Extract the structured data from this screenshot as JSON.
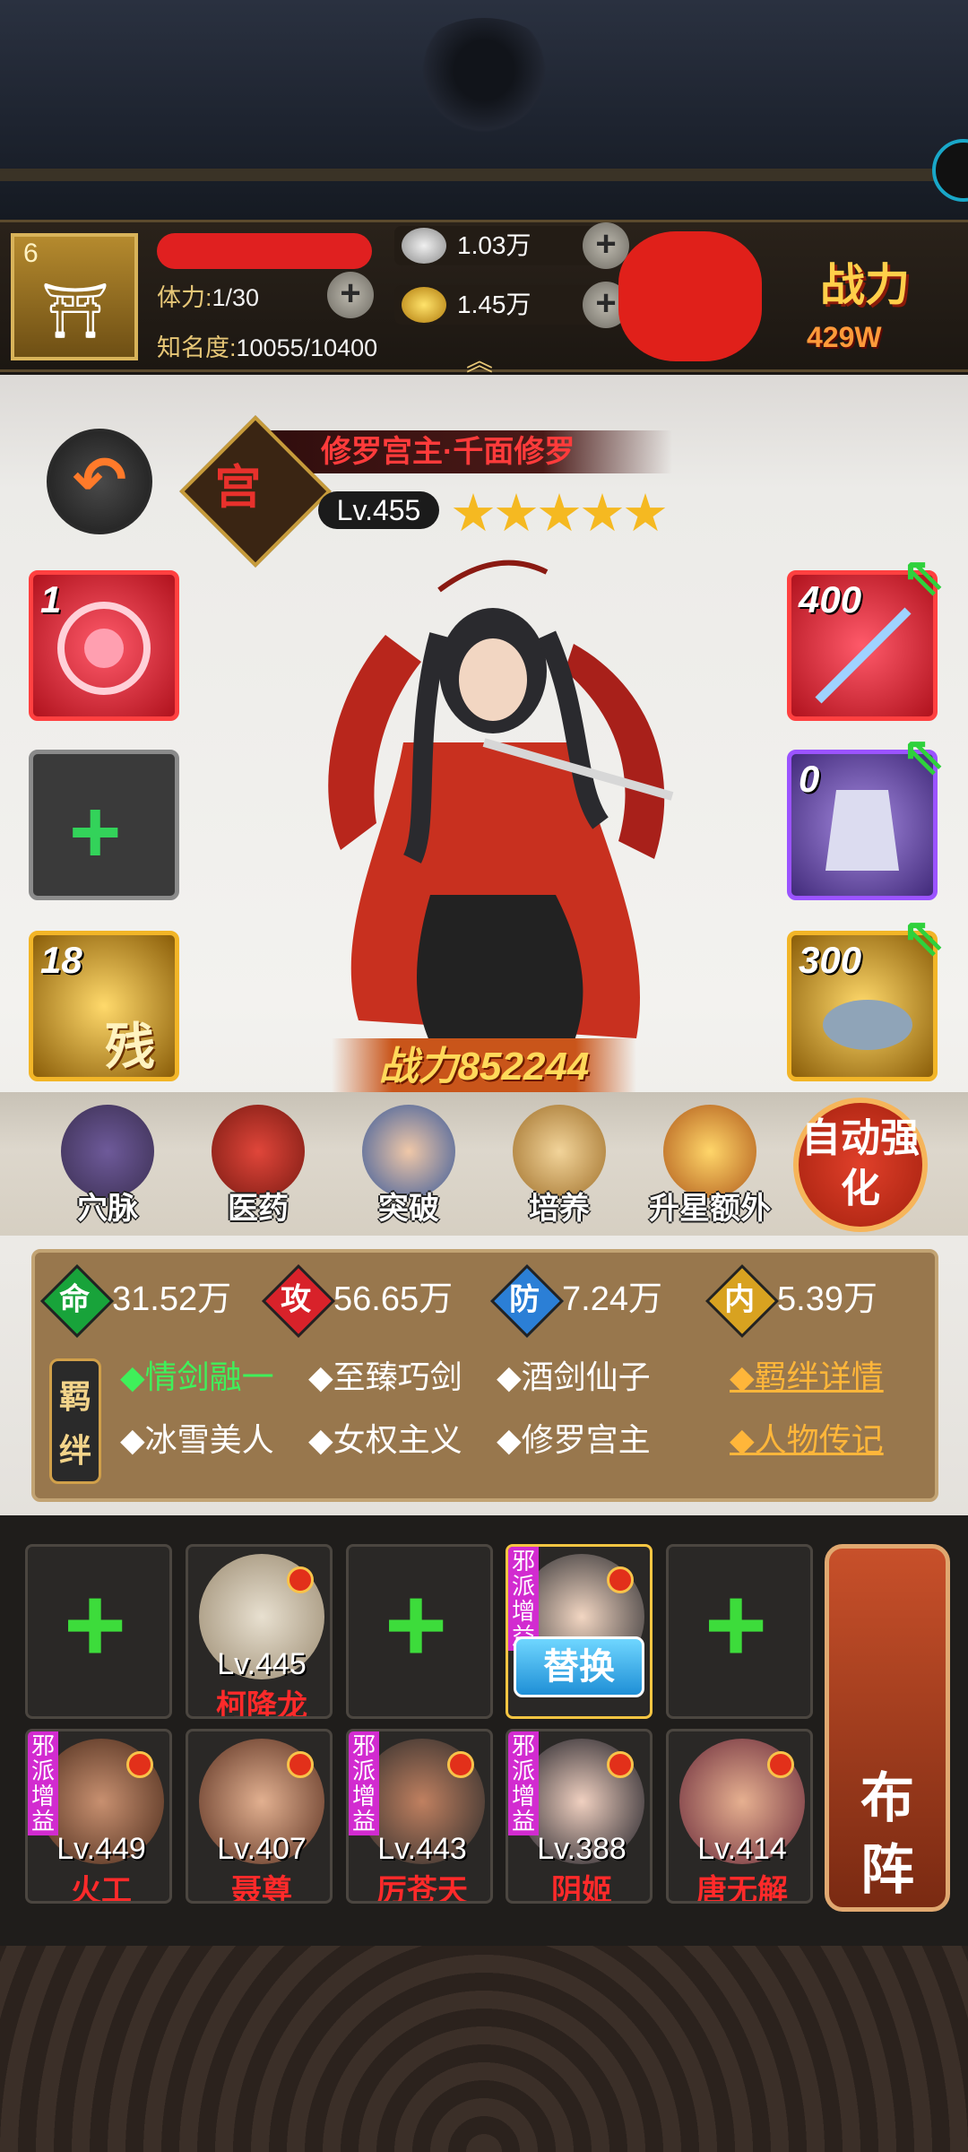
{
  "header": {
    "level": "6",
    "stamina_label": "体力:",
    "stamina_value": "1/30",
    "fame_label": "知名度:",
    "fame_value": "10055/10400",
    "silver": "1.03万",
    "gold": "1.45万",
    "power_label": "战力",
    "power_value": "429W"
  },
  "hero": {
    "class_char": "宫",
    "title": "修罗宫主·千面修罗",
    "level": "Lv.455",
    "stars": "★★★★★",
    "power_banner": "战力852244",
    "skill_slot_count": "1",
    "fate_slot_count": "18",
    "fate_char": "残",
    "weapon_count": "400",
    "armor_count": "0",
    "mount_count": "300"
  },
  "functions": [
    {
      "label": "穴脉",
      "icon": "meridian-icon"
    },
    {
      "label": "医药",
      "icon": "medicine-icon"
    },
    {
      "label": "突破",
      "icon": "breakthrough-icon"
    },
    {
      "label": "培养",
      "icon": "cultivate-icon"
    },
    {
      "label": "升星额外",
      "icon": "star-up-icon"
    }
  ],
  "auto_button": "自动强化",
  "attributes": [
    {
      "char": "命",
      "value": "31.52万",
      "color": "#18a33a"
    },
    {
      "char": "攻",
      "value": "56.65万",
      "color": "#d8222a"
    },
    {
      "char": "防",
      "value": "7.24万",
      "color": "#2b7fd6"
    },
    {
      "char": "内",
      "value": "5.39万",
      "color": "#d8a220"
    }
  ],
  "bonds_tag": "羁绊",
  "bonds": [
    {
      "label": "◆情剑融一",
      "active": true
    },
    {
      "label": "◆至臻巧剑",
      "active": false
    },
    {
      "label": "◆酒剑仙子",
      "active": false
    },
    {
      "label": "◆冰雪美人",
      "active": false
    },
    {
      "label": "◆女权主义",
      "active": false
    },
    {
      "label": "◆修罗宫主",
      "active": false
    }
  ],
  "bond_links": {
    "details": "◆羁绊详情",
    "biography": "◆人物传记"
  },
  "team": {
    "evil_tag": "邪派增益",
    "swap_label": "替换",
    "formation_label_1": "布",
    "formation_label_2": "阵",
    "top_row": [
      {
        "empty": true
      },
      {
        "level": "Lv.445",
        "name": "柯降龙"
      },
      {
        "empty": true
      },
      {
        "selected": true
      },
      {
        "empty": true
      }
    ],
    "bottom_row": [
      {
        "level": "Lv.449",
        "name": "火工"
      },
      {
        "level": "Lv.407",
        "name": "聂尊"
      },
      {
        "level": "Lv.443",
        "name": "厉苍天"
      },
      {
        "level": "Lv.388",
        "name": "阴姬"
      },
      {
        "level": "Lv.414",
        "name": "唐无解"
      }
    ]
  }
}
